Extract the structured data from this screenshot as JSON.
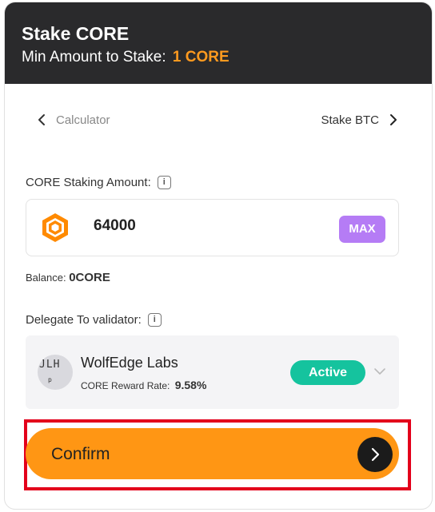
{
  "header": {
    "title": "Stake CORE",
    "subtitle_prefix": "Min Amount to Stake:",
    "min_amount": "1 CORE"
  },
  "nav": {
    "left_label": "Calculator",
    "right_label": "Stake BTC"
  },
  "amount": {
    "label": "CORE Staking Amount:",
    "value": "64000",
    "max_label": "MAX",
    "balance_prefix": "Balance:",
    "balance_value": "0CORE"
  },
  "validator": {
    "label": "Delegate To validator:",
    "name": "WolfEdge Labs",
    "rate_label": "CORE Reward Rate:",
    "rate_value": "9.58%",
    "status": "Active",
    "avatar_text_top": "JLH",
    "avatar_text_bottom": "p"
  },
  "confirm": {
    "label": "Confirm"
  },
  "colors": {
    "header_bg": "#2a2a2c",
    "accent": "#ff9614",
    "max_button": "#b57cf5",
    "active_badge": "#15c39e",
    "highlight": "#e3001b"
  },
  "icons": {
    "info": "info-icon",
    "core_logo": "core-logo-icon",
    "back": "chevron-left-icon",
    "forward": "chevron-right-icon",
    "dropdown": "chevron-down-icon",
    "confirm_arrow": "arrow-right-icon"
  }
}
